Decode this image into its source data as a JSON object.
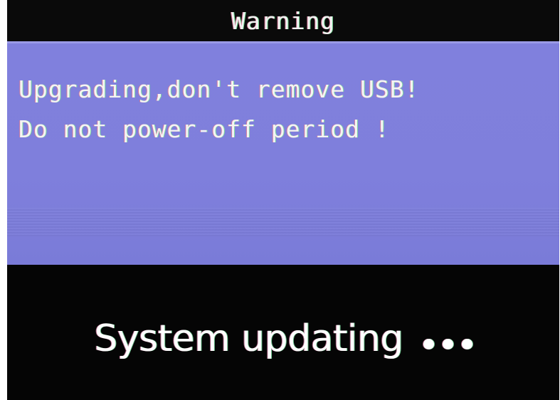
{
  "dialog": {
    "title": "Warning",
    "lines": [
      "Upgrading,don't remove USB!",
      "Do not power-off period !"
    ]
  },
  "status": {
    "text": "System updating",
    "indicator_icon": "ellipsis-icon"
  },
  "colors": {
    "screen_background": "#050505",
    "dialog_background": "#8080dd",
    "text": "#ffffff"
  }
}
